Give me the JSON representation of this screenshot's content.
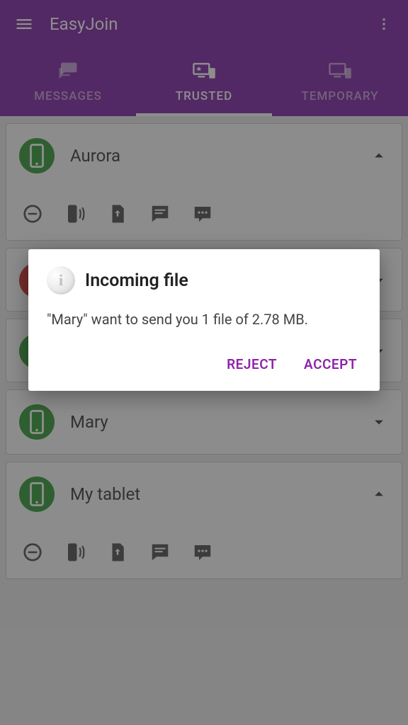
{
  "app": {
    "title": "EasyJoin"
  },
  "tabs": [
    {
      "id": "messages",
      "label": "MESSAGES"
    },
    {
      "id": "trusted",
      "label": "TRUSTED"
    },
    {
      "id": "temporary",
      "label": "TEMPORARY"
    }
  ],
  "active_tab": "trusted",
  "devices": [
    {
      "name": "Aurora",
      "color": "green",
      "expanded": true
    },
    {
      "name": "",
      "color": "red",
      "expanded": false
    },
    {
      "name": "",
      "color": "green",
      "expanded": false
    },
    {
      "name": "Mary",
      "color": "green",
      "expanded": false
    },
    {
      "name": "My tablet",
      "color": "green",
      "expanded": true
    }
  ],
  "dialog": {
    "title": "Incoming file",
    "message": "\"Mary\" want to send you 1 file of 2.78 MB.",
    "reject": "REJECT",
    "accept": "ACCEPT"
  }
}
